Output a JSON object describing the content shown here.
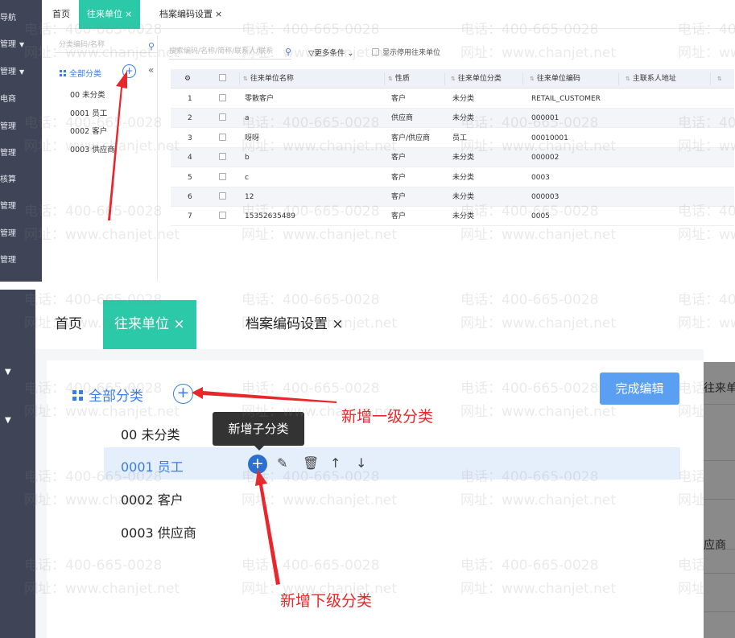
{
  "top": {
    "sidebar": [
      {
        "label": "导航",
        "caret": false
      },
      {
        "label": "管理",
        "caret": true
      },
      {
        "label": "管理",
        "caret": true
      },
      {
        "label": "电商",
        "caret": false
      },
      {
        "label": "管理",
        "caret": false
      },
      {
        "label": "管理",
        "caret": false
      },
      {
        "label": "核算",
        "caret": false
      },
      {
        "label": "管理",
        "caret": false
      },
      {
        "label": "管理",
        "caret": false
      },
      {
        "label": "管理",
        "caret": false
      }
    ],
    "tabs": [
      {
        "label": "首页",
        "closable": false,
        "active": false
      },
      {
        "label": "往来单位",
        "closable": true,
        "active": true
      },
      {
        "label": "档案编码设置",
        "closable": true,
        "active": false
      }
    ],
    "tree": {
      "search_placeholder": "分类编码/名称",
      "root_label": "全部分类",
      "nodes": [
        "00 未分类",
        "0001 员工",
        "0002 客户",
        "0003 供应商"
      ]
    },
    "filter": {
      "search_placeholder": "搜索编码/名称/简称/联系人/联系",
      "more_label": "更多条件",
      "show_disabled_label": "显示停用往来单位"
    },
    "table": {
      "columns": [
        "",
        "",
        "往来单位名称",
        "性质",
        "往来单位分类",
        "往来单位编码",
        "主联系人地址",
        ""
      ],
      "rows": [
        {
          "no": "1",
          "name": "零散客户",
          "nature": "客户",
          "category": "未分类",
          "code": "RETAIL_CUSTOMER"
        },
        {
          "no": "2",
          "name": "a",
          "nature": "供应商",
          "category": "未分类",
          "code": "000001"
        },
        {
          "no": "3",
          "name": "呀呀",
          "nature": "客户/供应商",
          "category": "员工",
          "code": "00010001"
        },
        {
          "no": "4",
          "name": "b",
          "nature": "客户",
          "category": "未分类",
          "code": "000002"
        },
        {
          "no": "5",
          "name": "c",
          "nature": "客户",
          "category": "未分类",
          "code": "0003"
        },
        {
          "no": "6",
          "name": "12",
          "nature": "客户",
          "category": "未分类",
          "code": "000003"
        },
        {
          "no": "7",
          "name": "15352635489",
          "nature": "客户",
          "category": "未分类",
          "code": "0005"
        }
      ]
    }
  },
  "bottom": {
    "tabs": [
      {
        "label": "首页",
        "closable": false,
        "active": false
      },
      {
        "label": "往来单位",
        "closable": true,
        "active": true
      },
      {
        "label": "档案编码设置",
        "closable": true,
        "active": false
      }
    ],
    "close_glyph": "×",
    "root_label": "全部分类",
    "done_button": "完成编辑",
    "nodes": [
      "00 未分类",
      "0001 员工",
      "0002 客户",
      "0003 供应商"
    ],
    "selected_node_index": 1,
    "tooltip": "新增子分类",
    "right_strip": [
      "往来单",
      "应商"
    ]
  },
  "annotations": {
    "add_top_level": "新增一级分类",
    "add_sub_level": "新增下级分类"
  },
  "watermark": {
    "phone": "电话：400-665-0028",
    "site": "网址：www.chanjet.net"
  },
  "colors": {
    "sidebar": "#3f4556",
    "active_tab": "#2cc9a8",
    "link_blue": "#3b7be8",
    "done_button": "#5b9ff2",
    "annotation_red": "#e8262b",
    "tooltip_bg": "#333333"
  },
  "icons": [
    "caret-down-icon",
    "search-icon",
    "grid-icon",
    "add-circle-icon",
    "collapse-icon",
    "gear-icon",
    "filter-icon",
    "sort-icon",
    "edit-icon",
    "delete-icon",
    "arrow-up-icon",
    "arrow-down-icon",
    "close-icon"
  ]
}
